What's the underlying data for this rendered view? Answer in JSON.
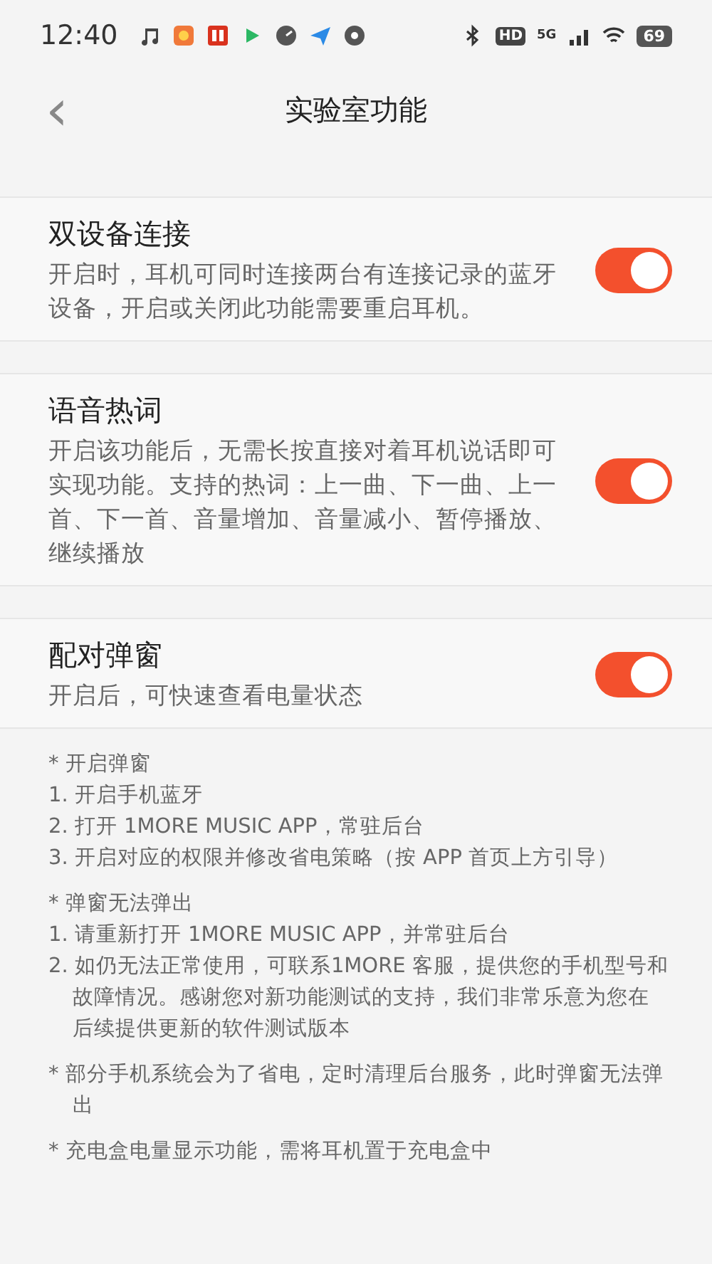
{
  "status_bar": {
    "time": "12:40",
    "hd": "HD",
    "network": "5G",
    "battery": "69"
  },
  "header": {
    "back": "‹",
    "title": "实验室功能"
  },
  "features": [
    {
      "title": "双设备连接",
      "description": "开启时，耳机可同时连接两台有连接记录的蓝牙设备，开启或关闭此功能需要重启耳机。",
      "on": true
    },
    {
      "title": "语音热词",
      "description": "开启该功能后，无需长按直接对着耳机说话即可实现功能。支持的热词：上一曲、下一曲、上一首、下一首、音量增加、音量减小、暂停播放、继续播放",
      "on": true
    },
    {
      "title": "配对弹窗",
      "description": "开启后，可快速查看电量状态",
      "on": true
    }
  ],
  "notes": [
    {
      "lines": [
        "* 开启弹窗",
        "1. 开启手机蓝牙",
        "2. 打开 1MORE MUSIC APP，常驻后台",
        "3. 开启对应的权限并修改省电策略（按 APP 首页上方引导）"
      ]
    },
    {
      "lines": [
        "* 弹窗无法弹出",
        "1. 请重新打开 1MORE MUSIC APP，并常驻后台",
        "2. 如仍无法正常使用，可联系1MORE 客服，提供您的手机型号和故障情况。感谢您对新功能测试的支持，我们非常乐意为您在后续提供更新的软件测试版本"
      ]
    },
    {
      "lines": [
        "* 部分手机系统会为了省电，定时清理后台服务，此时弹窗无法弹出"
      ]
    },
    {
      "lines": [
        "* 充电盒电量显示功能，需将耳机置于充电盒中"
      ]
    }
  ]
}
